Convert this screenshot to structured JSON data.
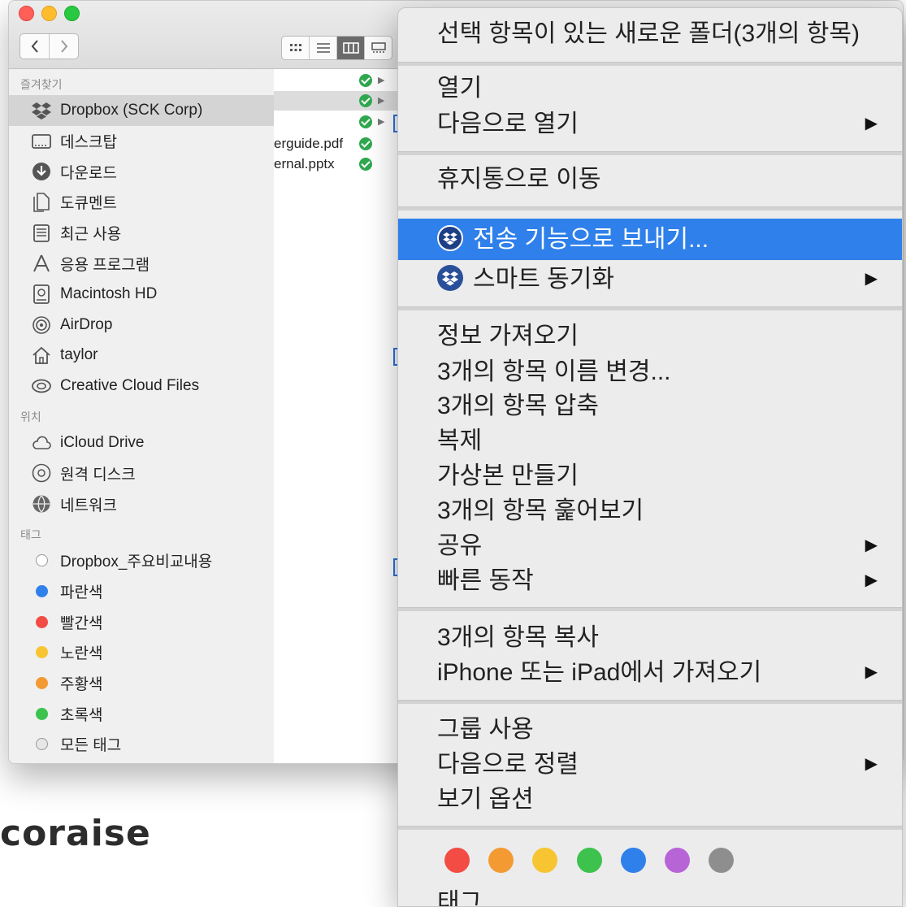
{
  "sidebar": {
    "favorites_header": "즐겨찾기",
    "favorites": [
      {
        "label": "Dropbox (SCK Corp)",
        "icon": "dropbox-icon"
      },
      {
        "label": "데스크탑",
        "icon": "desktop-icon"
      },
      {
        "label": "다운로드",
        "icon": "downloads-icon"
      },
      {
        "label": "도큐멘트",
        "icon": "documents-icon"
      },
      {
        "label": "최근 사용",
        "icon": "recents-icon"
      },
      {
        "label": "응용 프로그램",
        "icon": "applications-icon"
      },
      {
        "label": "Macintosh HD",
        "icon": "harddisk-icon"
      },
      {
        "label": "AirDrop",
        "icon": "airdrop-icon"
      },
      {
        "label": "taylor",
        "icon": "home-icon"
      },
      {
        "label": "Creative Cloud Files",
        "icon": "creative-cloud-icon"
      }
    ],
    "locations_header": "위치",
    "locations": [
      {
        "label": "iCloud Drive",
        "icon": "cloud-icon"
      },
      {
        "label": "원격 디스크",
        "icon": "disc-icon"
      },
      {
        "label": "네트워크",
        "icon": "network-icon"
      }
    ],
    "tags_header": "태그",
    "tags": [
      {
        "label": "Dropbox_주요비교내용",
        "color": "#ffffff"
      },
      {
        "label": "파란색",
        "color": "#2f80ea"
      },
      {
        "label": "빨간색",
        "color": "#f24c45"
      },
      {
        "label": "노란색",
        "color": "#f7c531"
      },
      {
        "label": "주황색",
        "color": "#f39a33"
      },
      {
        "label": "초록색",
        "color": "#3cc24d"
      },
      {
        "label": "모든 태그",
        "color": "#e6e6e6"
      }
    ]
  },
  "files": [
    {
      "name": ""
    },
    {
      "name": ""
    },
    {
      "name": ""
    },
    {
      "name": "erguide.pdf"
    },
    {
      "name": "ernal.pptx"
    }
  ],
  "menu": {
    "new_folder": "선택 항목이 있는 새로운 폴더(3개의 항목)",
    "open": "열기",
    "open_with": "다음으로 열기",
    "move_to_trash": "휴지통으로 이동",
    "send_transfer": "전송 기능으로 보내기...",
    "smart_sync": "스마트 동기화",
    "get_info": "정보 가져오기",
    "rename": "3개의 항목 이름 변경...",
    "compress": "3개의 항목 압축",
    "duplicate": "복제",
    "make_alias": "가상본 만들기",
    "quick_look": "3개의 항목 훑어보기",
    "share": "공유",
    "quick_actions": "빠른 동작",
    "copy": "3개의 항목 복사",
    "import_iphone": "iPhone 또는 iPad에서 가져오기",
    "use_groups": "그룹 사용",
    "sort_by": "다음으로 정렬",
    "view_options": "보기 옵션",
    "tags_label": "태그",
    "tag_colors": [
      "#f24c45",
      "#f39a33",
      "#f7c531",
      "#3cc24d",
      "#2f80ea",
      "#b764d6",
      "#8e8e8e"
    ]
  },
  "brand_text": "coraise"
}
